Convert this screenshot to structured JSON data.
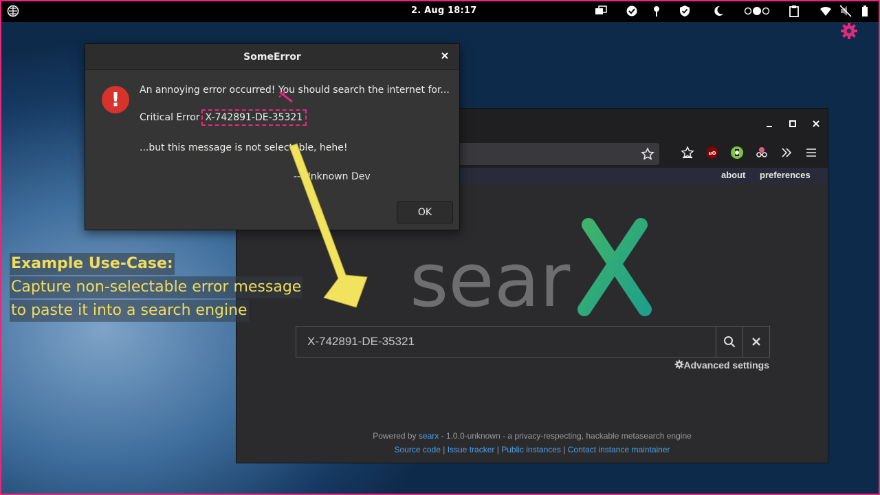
{
  "topbar": {
    "clock": "2. Aug  18:17"
  },
  "dialog": {
    "title": "SomeError",
    "line1": "An annoying error occurred! You should search the internet for...",
    "line2_prefix": "Critical Error",
    "error_code": "X-742891-DE-35321",
    "line3": "...but this message is not selectable, hehe!",
    "signature": "-- Unknown Dev",
    "ok_label": "OK"
  },
  "annotation": {
    "heading": "Example Use-Case:",
    "line1": "Capture non-selectable error message",
    "line2": "to paste it into a search engine"
  },
  "searx": {
    "nav_about": "about",
    "nav_preferences": "preferences",
    "logo_text": "sear",
    "search_value": "X-742891-DE-35321",
    "advanced_settings": "Advanced settings",
    "footer": {
      "powered_by": "Powered by",
      "searx_link": "searx",
      "version_text": "- 1.0.0-unknown - a privacy-respecting, hackable metasearch engine",
      "links": [
        "Source code",
        "Issue tracker",
        "Public instances",
        "Contact instance maintainer"
      ],
      "separator": "|"
    }
  },
  "colors": {
    "accent_pink": "#e8287a",
    "annotation_yellow": "#f2dc5a",
    "error_red": "#d7332c",
    "searx_green_start": "#3fb36b",
    "searx_green_end": "#1fa08a",
    "link_blue": "#4ea0e6"
  }
}
